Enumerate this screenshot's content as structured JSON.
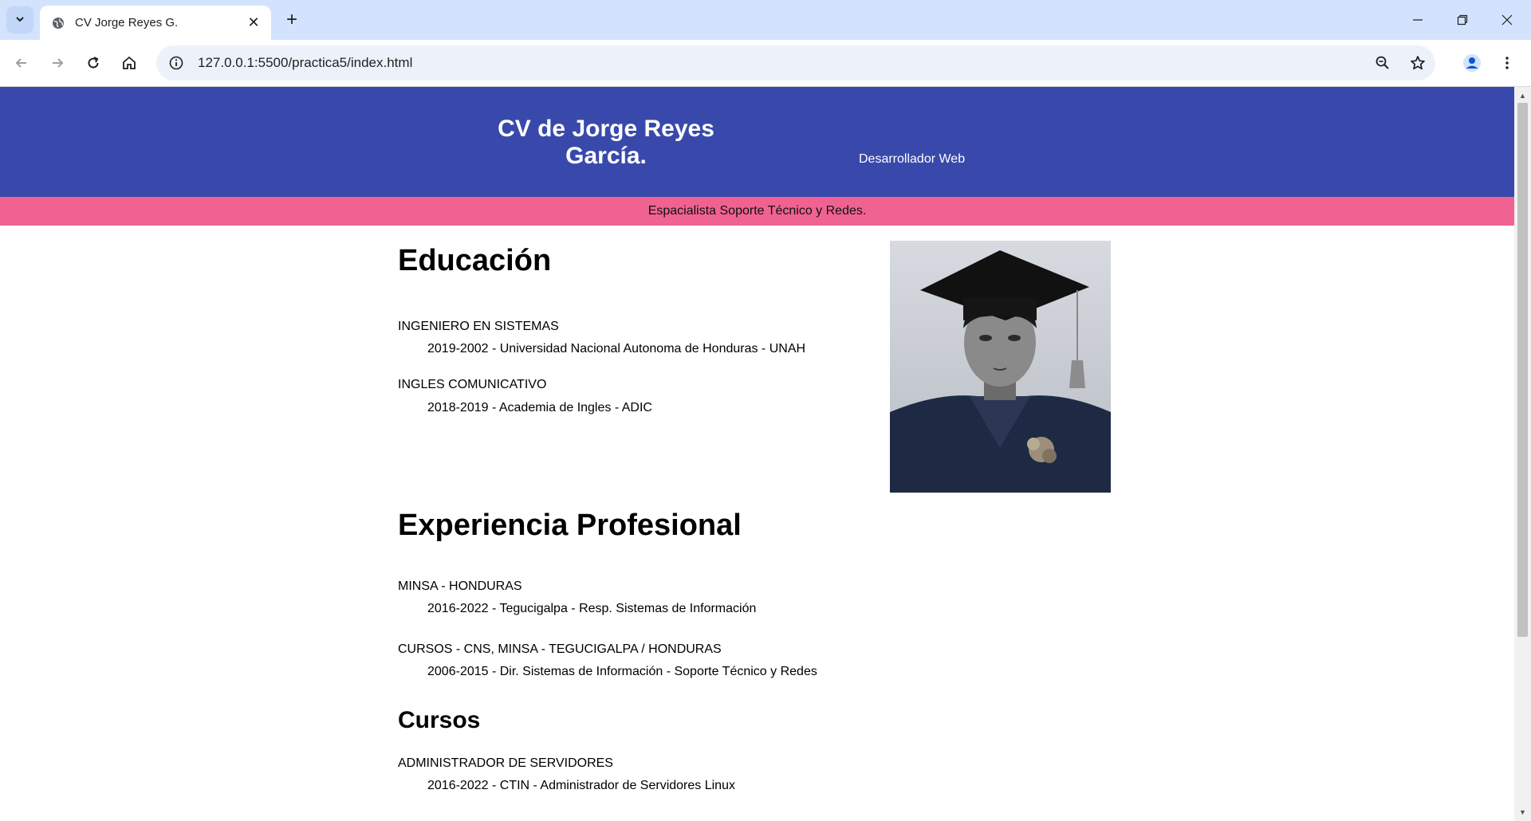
{
  "browser": {
    "tab_title": "CV Jorge Reyes G.",
    "url": "127.0.0.1:5500/practica5/index.html"
  },
  "header": {
    "title": "CV de Jorge Reyes García.",
    "role": "Desarrollador Web",
    "banner": "Espacialista Soporte Técnico y Redes."
  },
  "education": {
    "heading": "Educación",
    "items": [
      {
        "title": "INGENIERO EN SISTEMAS",
        "detail": "2019-2002 - Universidad Nacional Autonoma de Honduras - UNAH"
      },
      {
        "title": "INGLES COMUNICATIVO",
        "detail": "2018-2019 - Academia de Ingles - ADIC"
      }
    ]
  },
  "experience": {
    "heading": "Experiencia Profesional",
    "items": [
      {
        "title": "MINSA - HONDURAS",
        "detail": "2016-2022 - Tegucigalpa - Resp. Sistemas de Información"
      },
      {
        "title": "CURSOS - CNS, MINSA - TEGUCIGALPA / HONDURAS",
        "detail": "2006-2015 - Dir. Sistemas de Información - Soporte Técnico y Redes"
      }
    ]
  },
  "courses": {
    "heading": "Cursos",
    "items": [
      {
        "title": "ADMINISTRADOR DE SERVIDORES",
        "detail": "2016-2022 - CTIN - Administrador de Servidores Linux"
      }
    ]
  },
  "colors": {
    "header_bg": "#3949ab",
    "banner_bg": "#f06292",
    "chrome_bg": "#d3e3fd"
  }
}
